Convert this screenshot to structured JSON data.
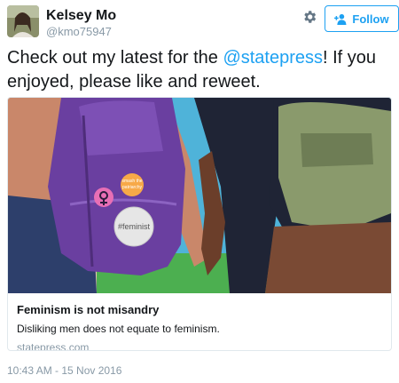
{
  "author": {
    "name": "Kelsey Mo",
    "handle": "@kmo75947"
  },
  "header": {
    "settings_icon": "gear-icon",
    "follow_icon": "add-user-icon",
    "follow_label": "Follow"
  },
  "tweet": {
    "text_before": "Check out my latest for the ",
    "mention": "@statepress",
    "text_after": "! If you enjoyed, please like and reweet.",
    "timestamp": "10:43 AM - 15 Nov 2016"
  },
  "card": {
    "image_badge_text": "#feminist",
    "image_pin_text": "smash the patriarchy",
    "title": "Feminism is not misandry",
    "description": "Disliking men does not equate to feminism.",
    "domain": "statepress.com"
  },
  "colors": {
    "accent": "#1da1f2",
    "muted": "#8899a6",
    "backpack": "#6a3fa0"
  }
}
